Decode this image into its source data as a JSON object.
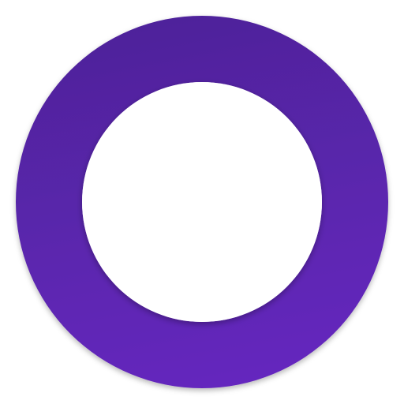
{
  "logo": {
    "shape": "ring",
    "icon": "ring-logo-icon",
    "colors": {
      "gradient_top": "#4E239A",
      "gradient_bottom": "#6528BE",
      "inner_fill": "#FFFFFF",
      "background": "#FFFFFF"
    }
  }
}
